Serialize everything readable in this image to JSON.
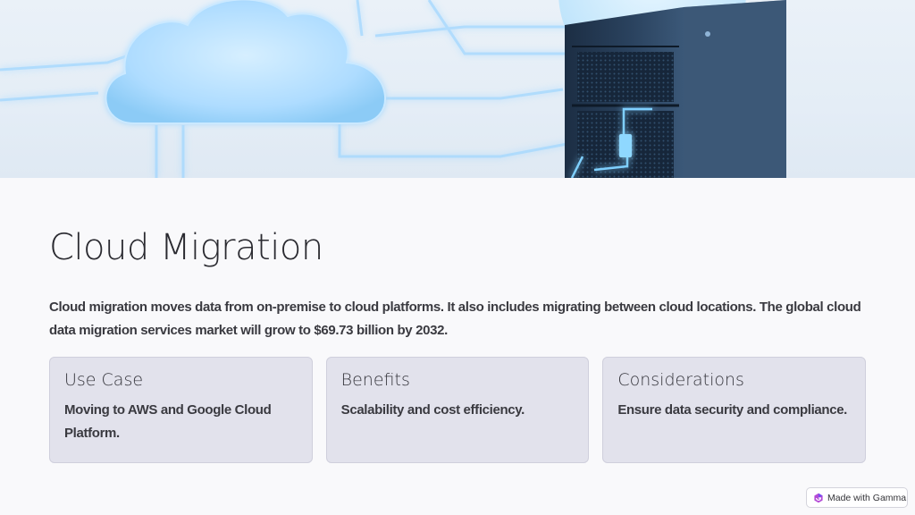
{
  "slide": {
    "title": "Cloud Migration",
    "intro": "Cloud migration moves data from on-premise to cloud platforms. It also includes migrating between cloud locations. The global cloud data migration services market will grow to $69.73 billion by 2032."
  },
  "cards": [
    {
      "title": "Use Case",
      "text": "Moving to AWS and Google Cloud Platform."
    },
    {
      "title": "Benefits",
      "text": "Scalability and cost efficiency."
    },
    {
      "title": "Considerations",
      "text": "Ensure data security and compliance."
    }
  ],
  "badge": {
    "label": "Made with Gamma",
    "icon": "gamma-logo-icon"
  },
  "hero": {
    "icons": [
      "cloud-icon",
      "server-rack-icon"
    ]
  },
  "colors": {
    "background": "#f9f9fb",
    "card": "#e2e2ec",
    "text": "#3a3a40",
    "accent_glow": "#7fd0ff"
  }
}
